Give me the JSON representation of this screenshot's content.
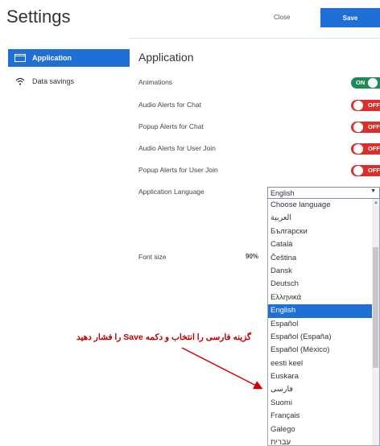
{
  "header": {
    "title": "Settings",
    "close_label": "Close",
    "save_label": "Save"
  },
  "sidebar": {
    "items": [
      {
        "label": "Application",
        "icon": "window-icon",
        "active": true
      },
      {
        "label": "Data savings",
        "icon": "wifi-icon",
        "active": false
      }
    ]
  },
  "main": {
    "section_title": "Application",
    "toggles": [
      {
        "label": "Animations",
        "state": "ON"
      },
      {
        "label": "Audio Alerts for Chat",
        "state": "OFF"
      },
      {
        "label": "Popup Alerts for Chat",
        "state": "OFF"
      },
      {
        "label": "Audio Alerts for User Join",
        "state": "OFF"
      },
      {
        "label": "Popup Alerts for User Join",
        "state": "OFF"
      }
    ],
    "language_label": "Application Language",
    "language_selected": "English",
    "language_options": [
      "Choose language",
      "العربية",
      "Български",
      "Català",
      "Čeština",
      "Dansk",
      "Deutsch",
      "Ελληνικά",
      "English",
      "Español",
      "Español (España)",
      "Español (México)",
      "eesti keel",
      "Euskara",
      "فارسی",
      "Suomi",
      "Français",
      "Galego",
      "עברית"
    ],
    "font_size_label": "Font size",
    "font_size_value": "90%"
  },
  "annotation": {
    "text": "گزینه فارسی را انتخاب و دکمه Save را فشار دهید"
  },
  "colors": {
    "accent": "#1f6fd6",
    "on": "#1e8a5a",
    "off": "#d9302c",
    "annotation": "#c00000"
  }
}
